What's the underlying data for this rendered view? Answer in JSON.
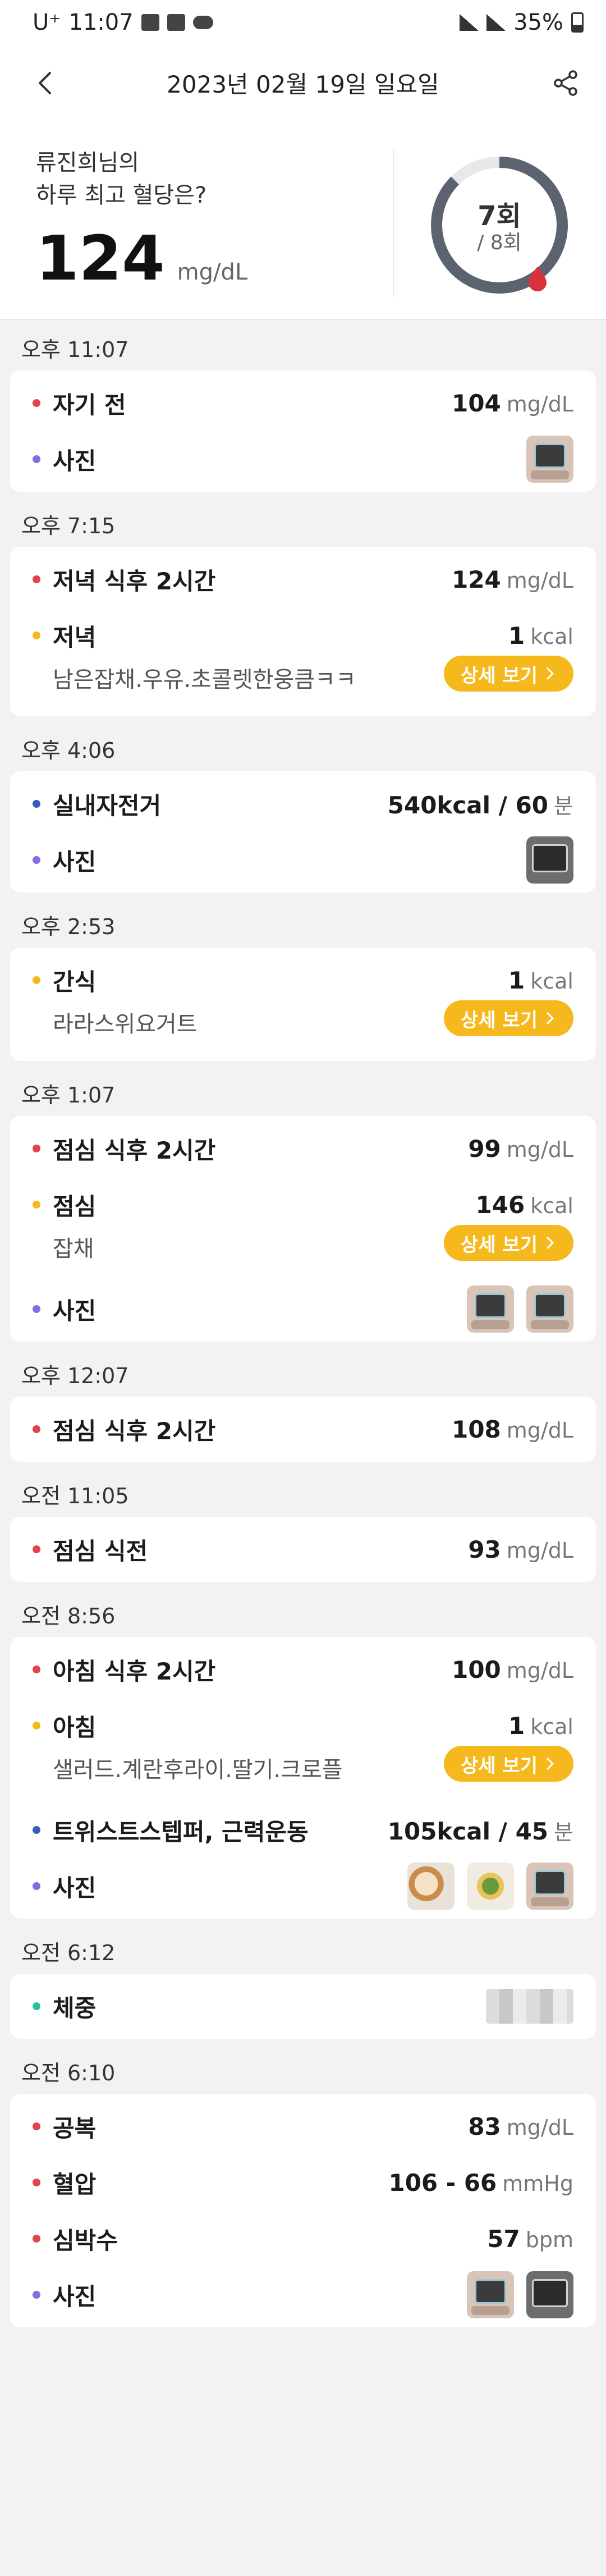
{
  "status_bar": {
    "carrier": "U⁺",
    "time": "11:07",
    "battery": "35%"
  },
  "app_bar": {
    "title": "2023년 02월 19일 일요일"
  },
  "summary": {
    "question_line1": "류진희님의",
    "question_line2": "하루 최고 혈당은?",
    "max_value": "124",
    "unit": "mg/dL",
    "count": "7회",
    "total": "/ 8회",
    "progress_fraction": 0.875
  },
  "groups": [
    {
      "time": "오후 11:07",
      "rows": [
        {
          "label": "자기 전",
          "value": "104",
          "unit": "mg/dL",
          "dot": "red"
        },
        {
          "label": "사진",
          "dot": "purple",
          "photos": [
            "meter"
          ]
        }
      ]
    },
    {
      "time": "오후 7:15",
      "rows": [
        {
          "label": "저녁 식후 2시간",
          "value": "124",
          "unit": "mg/dL",
          "dot": "red"
        },
        {
          "label": "저녁",
          "value": "1",
          "unit": "kcal",
          "dot": "yellow",
          "sub": "남은잡채.우유.초콜렛한웅큼ㅋㅋ",
          "button": "상세 보기"
        }
      ]
    },
    {
      "time": "오후 4:06",
      "rows": [
        {
          "label": "실내자전거",
          "value": "540kcal / 60",
          "unit": "분",
          "dot": "blue"
        },
        {
          "label": "사진",
          "dot": "purple",
          "photos": [
            "dark"
          ]
        }
      ]
    },
    {
      "time": "오후 2:53",
      "rows": [
        {
          "label": "간식",
          "value": "1",
          "unit": "kcal",
          "dot": "yellow",
          "sub": "라라스위요거트",
          "button": "상세 보기"
        }
      ]
    },
    {
      "time": "오후 1:07",
      "rows": [
        {
          "label": "점심 식후 2시간",
          "value": "99",
          "unit": "mg/dL",
          "dot": "red"
        },
        {
          "label": "점심",
          "value": "146",
          "unit": "kcal",
          "dot": "yellow",
          "sub": "잡채",
          "button": "상세 보기"
        },
        {
          "label": "사진",
          "dot": "purple",
          "photos": [
            "meter",
            "meter"
          ]
        }
      ]
    },
    {
      "time": "오후 12:07",
      "rows": [
        {
          "label": "점심 식후 2시간",
          "value": "108",
          "unit": "mg/dL",
          "dot": "red"
        }
      ]
    },
    {
      "time": "오전 11:05",
      "rows": [
        {
          "label": "점심 식전",
          "value": "93",
          "unit": "mg/dL",
          "dot": "red"
        }
      ]
    },
    {
      "time": "오전 8:56",
      "rows": [
        {
          "label": "아침 식후 2시간",
          "value": "100",
          "unit": "mg/dL",
          "dot": "red"
        },
        {
          "label": "아침",
          "value": "1",
          "unit": "kcal",
          "dot": "yellow",
          "sub": "샐러드.계란후라이.딸기.크로플",
          "button": "상세 보기"
        },
        {
          "label": "트위스트스텝퍼, 근력운동",
          "value": "105kcal / 45",
          "unit": "분",
          "dot": "blue"
        },
        {
          "label": "사진",
          "dot": "purple",
          "photos": [
            "food",
            "food2",
            "meter"
          ]
        }
      ]
    },
    {
      "time": "오전 6:12",
      "rows": [
        {
          "label": "체중",
          "dot": "teal",
          "photos": [
            "blur"
          ]
        }
      ]
    },
    {
      "time": "오전 6:10",
      "rows": [
        {
          "label": "공복",
          "value": "83",
          "unit": "mg/dL",
          "dot": "red"
        },
        {
          "label": "혈압",
          "value": "106 - 66",
          "unit": "mmHg",
          "dot": "red"
        },
        {
          "label": "심박수",
          "value": "57",
          "unit": "bpm",
          "dot": "red"
        },
        {
          "label": "사진",
          "dot": "purple",
          "photos": [
            "meter",
            "dark"
          ]
        }
      ]
    }
  ],
  "colors": {
    "accent": "#f5b91e",
    "glucose": "#e0454b",
    "photo": "#8a6ae0",
    "exercise": "#3a5bb8",
    "weight": "#2bbfa4",
    "ring_track": "#5c6370"
  },
  "icons": [
    "back-arrow-icon",
    "share-icon",
    "blood-drop-icon",
    "chevron-right-icon"
  ]
}
